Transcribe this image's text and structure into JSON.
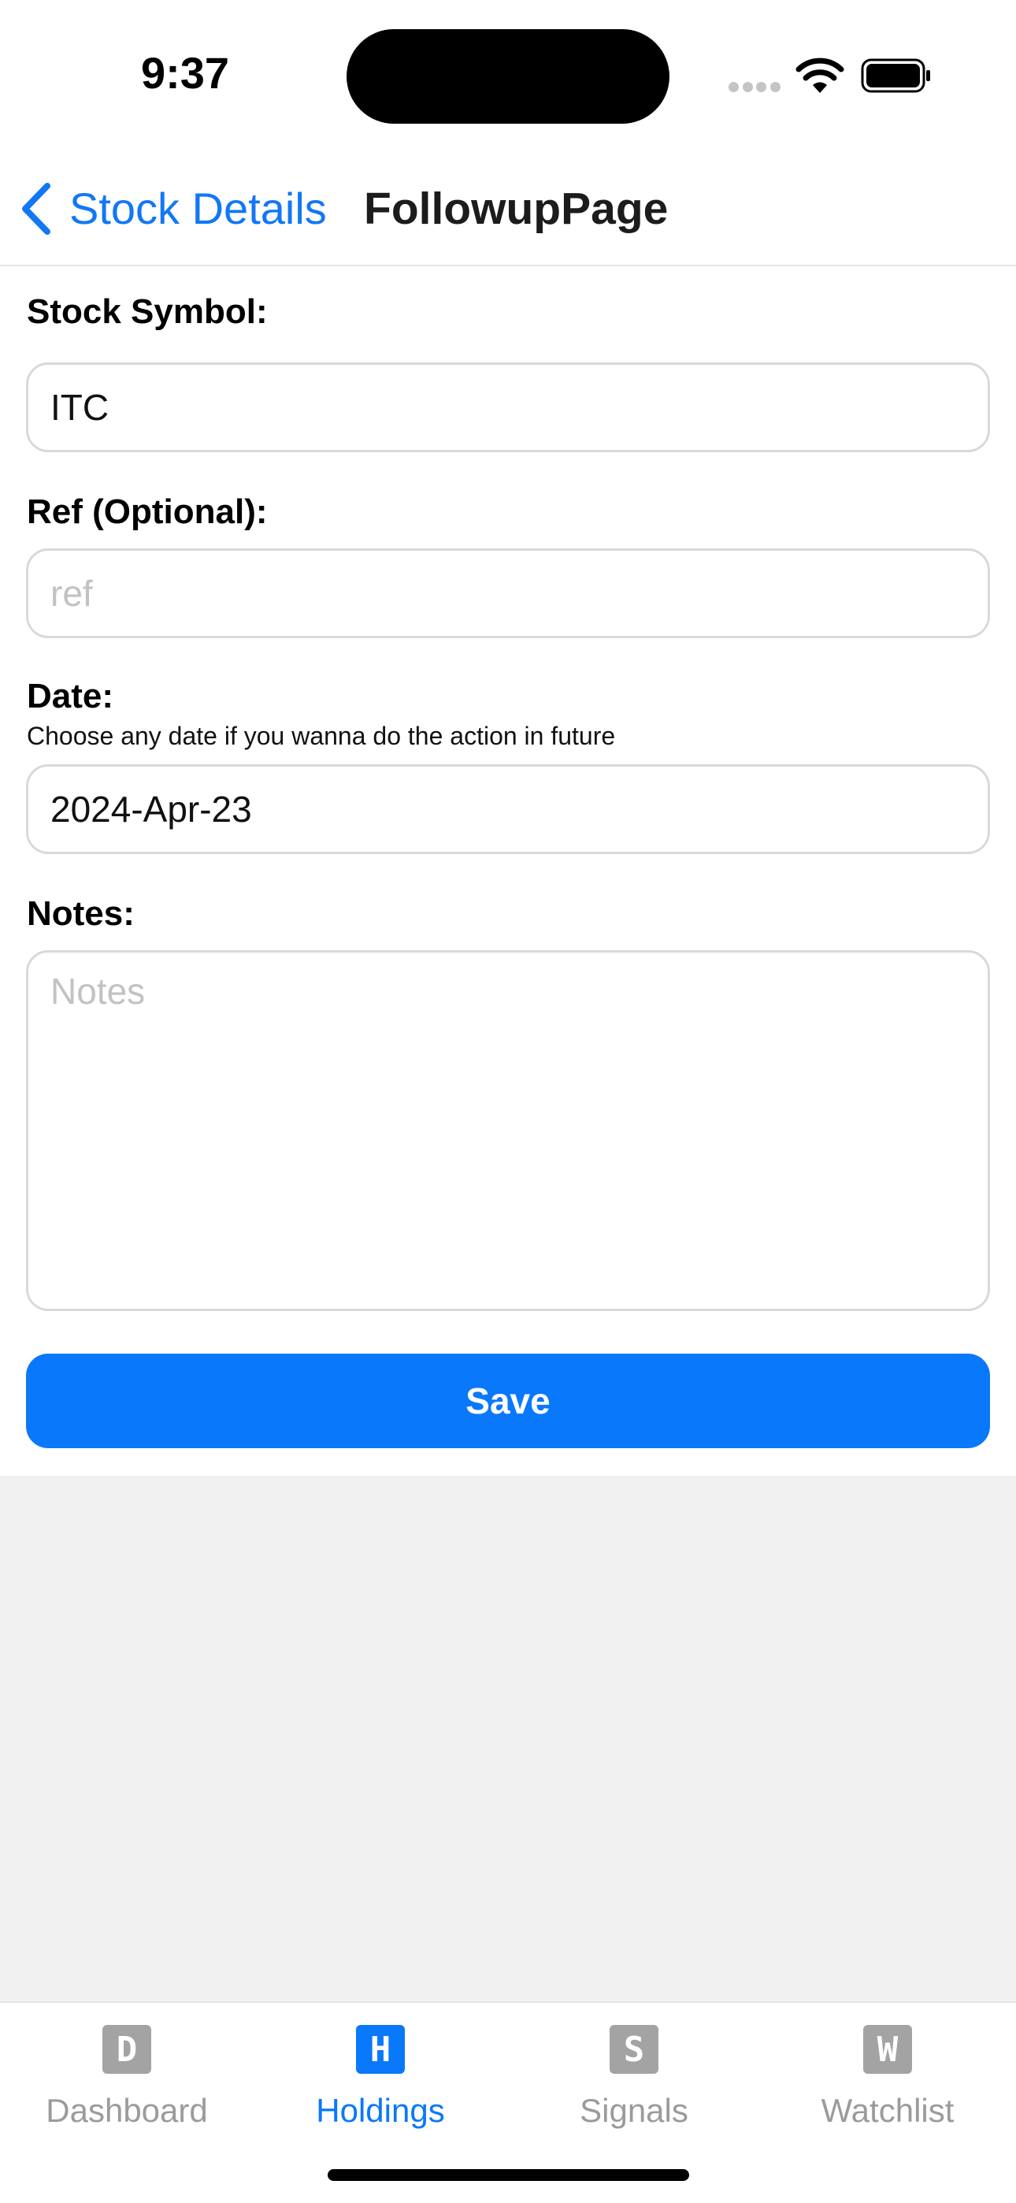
{
  "status_bar": {
    "time": "9:37"
  },
  "nav": {
    "back_label": "Stock Details",
    "title": "FollowupPage"
  },
  "form": {
    "symbol": {
      "label": "Stock Symbol:",
      "value": "ITC"
    },
    "ref": {
      "label": "Ref (Optional):",
      "placeholder": "ref",
      "value": ""
    },
    "date": {
      "label": "Date:",
      "hint": "Choose any date if you wanna do the action in future",
      "value": "2024-Apr-23"
    },
    "notes": {
      "label": "Notes:",
      "placeholder": "Notes",
      "value": ""
    },
    "save_label": "Save"
  },
  "tabs": [
    {
      "icon_letter": "D",
      "label": "Dashboard",
      "icon": "dashboard-icon",
      "active": false
    },
    {
      "icon_letter": "H",
      "label": "Holdings",
      "icon": "holdings-icon",
      "active": true
    },
    {
      "icon_letter": "S",
      "label": "Signals",
      "icon": "signals-icon",
      "active": false
    },
    {
      "icon_letter": "W",
      "label": "Watchlist",
      "icon": "watchlist-icon",
      "active": false
    }
  ],
  "colors": {
    "accent": "#0a78fb",
    "link": "#1277f5",
    "inactive_tab": "#9b9b9b",
    "background_fill": "#f1f1f1"
  }
}
